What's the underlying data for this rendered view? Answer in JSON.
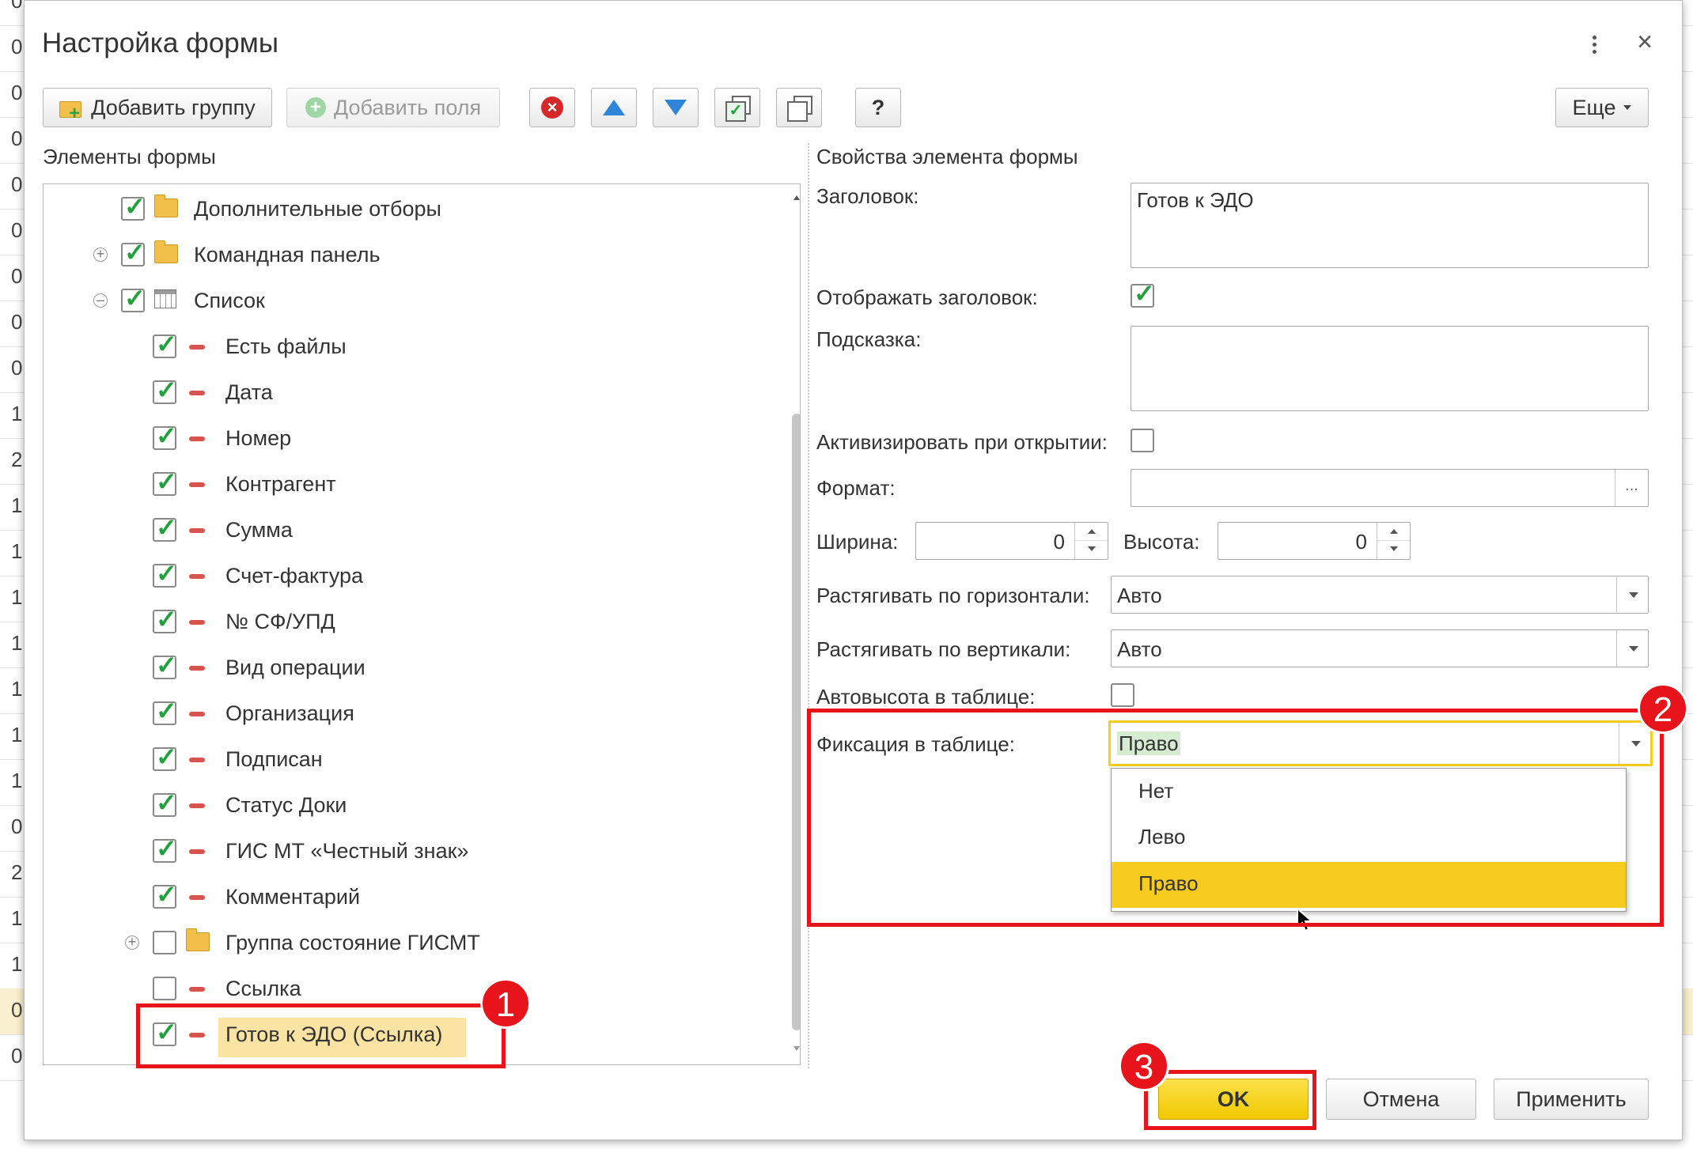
{
  "background": {
    "row_numbers": [
      "0",
      "0",
      "0",
      "0",
      "0",
      "0",
      "0",
      "0",
      "0",
      "1",
      "2",
      "1",
      "1",
      "1",
      "1",
      "1",
      "1",
      "1",
      "0",
      "2",
      "1",
      "1",
      "0",
      "0"
    ]
  },
  "dialog": {
    "title": "Настройка формы",
    "more_menu_icon": "kebab-menu-icon",
    "close_icon": "close-icon"
  },
  "toolbar": {
    "add_group_label": "Добавить группу",
    "add_fields_label": "Добавить поля",
    "more_label": "Еще",
    "help_label": "?"
  },
  "left_panel": {
    "header": "Элементы формы",
    "items": [
      {
        "label": "Дополнительные отборы",
        "checked": true,
        "icon": "folder-icon"
      },
      {
        "label": "Командная панель",
        "checked": true,
        "icon": "folder-icon",
        "expander": "⊕"
      },
      {
        "label": "Список",
        "checked": true,
        "icon": "table-icon",
        "expander": "⊖"
      },
      {
        "label": "Есть файлы",
        "checked": true,
        "icon": "field-icon"
      },
      {
        "label": "Дата",
        "checked": true,
        "icon": "field-icon"
      },
      {
        "label": "Номер",
        "checked": true,
        "icon": "field-icon"
      },
      {
        "label": "Контрагент",
        "checked": true,
        "icon": "field-icon"
      },
      {
        "label": "Сумма",
        "checked": true,
        "icon": "field-icon"
      },
      {
        "label": "Счет-фактура",
        "checked": true,
        "icon": "field-icon"
      },
      {
        "label": "№ СФ/УПД",
        "checked": true,
        "icon": "field-icon"
      },
      {
        "label": "Вид операции",
        "checked": true,
        "icon": "field-icon"
      },
      {
        "label": "Организация",
        "checked": true,
        "icon": "field-icon"
      },
      {
        "label": "Подписан",
        "checked": true,
        "icon": "field-icon"
      },
      {
        "label": "Статус Доки",
        "checked": true,
        "icon": "field-icon"
      },
      {
        "label": "ГИС МТ «Честный знак»",
        "checked": true,
        "icon": "field-icon"
      },
      {
        "label": "Комментарий",
        "checked": true,
        "icon": "field-icon"
      },
      {
        "label": "Группа состояние ГИСМТ",
        "checked": false,
        "icon": "folder-icon",
        "expander": "⊕"
      },
      {
        "label": "Ссылка",
        "checked": false,
        "icon": "field-icon"
      },
      {
        "label": "Готов к ЭДО (Ссылка)",
        "checked": true,
        "icon": "field-icon",
        "selected": true
      }
    ]
  },
  "right_panel": {
    "header": "Свойства элемента формы",
    "title_label": "Заголовок:",
    "title_value": "Готов к ЭДО",
    "show_title_label": "Отображать заголовок:",
    "show_title_checked": true,
    "hint_label": "Подсказка:",
    "hint_value": "",
    "activate_label": "Активизировать при открытии:",
    "activate_checked": false,
    "format_label": "Формат:",
    "format_value": "",
    "format_button": "...",
    "width_label": "Ширина:",
    "width_value": "0",
    "height_label": "Высота:",
    "height_value": "0",
    "stretch_h_label": "Растягивать по горизонтали:",
    "stretch_h_value": "Авто",
    "stretch_v_label": "Растягивать по вертикали:",
    "stretch_v_value": "Авто",
    "autoheight_label": "Автовысота в таблице:",
    "autoheight_checked": false,
    "fix_label": "Фиксация в таблице:",
    "fix_value": "Право",
    "fix_options": [
      "Нет",
      "Лево",
      "Право"
    ],
    "fix_selected_index": 2
  },
  "footer": {
    "ok_label": "OK",
    "cancel_label": "Отмена",
    "apply_label": "Применить"
  },
  "annotations": {
    "badge1": "1",
    "badge2": "2",
    "badge3": "3"
  },
  "colors": {
    "highlight_red": "#e8141c",
    "accent_yellow": "#f8cb1f",
    "selected_row": "#fbe3a3",
    "check_green": "#21a03b"
  }
}
